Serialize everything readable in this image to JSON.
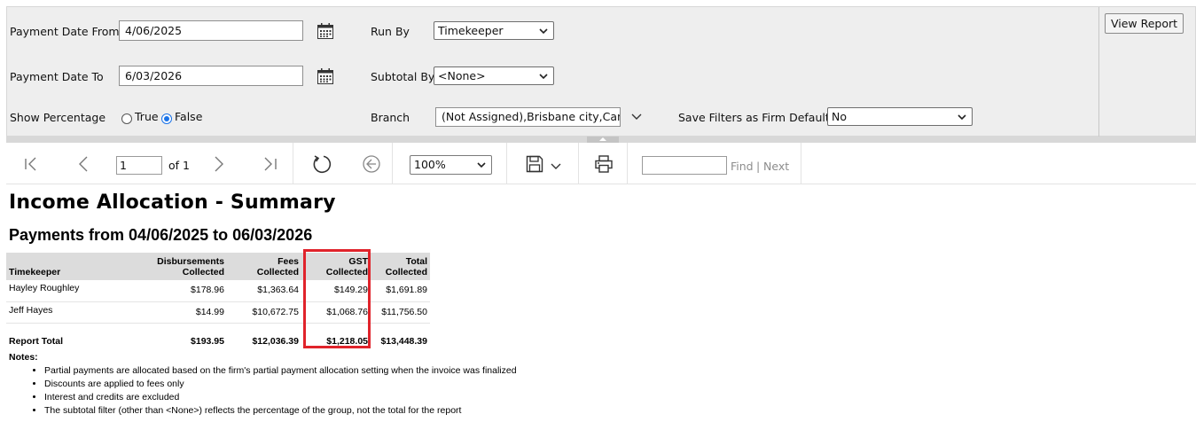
{
  "filters": {
    "payment_date_from": {
      "label": "Payment Date From",
      "value": "4/06/2025"
    },
    "payment_date_to": {
      "label": "Payment Date To",
      "value": "6/03/2026"
    },
    "show_percentage": {
      "label": "Show Percentage",
      "options": [
        "True",
        "False"
      ],
      "selected": "False"
    },
    "run_by": {
      "label": "Run By",
      "value": "Timekeeper"
    },
    "subtotal_by": {
      "label": "Subtotal By",
      "value": "<None>"
    },
    "branch": {
      "label": "Branch",
      "value": "(Not Assigned),Brisbane city,Canbe"
    },
    "save_filters": {
      "label": "Save Filters as Firm Default?",
      "value": "No"
    },
    "view_report_label": "View Report"
  },
  "toolbar": {
    "page_value": "1",
    "page_of": "of 1",
    "zoom": "100%",
    "find_value": "",
    "find_label": "Find",
    "find_sep": "|",
    "next_label": "Next"
  },
  "report": {
    "title": "Income Allocation - Summary",
    "subtitle": "Payments from 04/06/2025 to 06/03/2026",
    "columns": [
      {
        "line1": "",
        "line2": "Timekeeper"
      },
      {
        "line1": "Disbursements",
        "line2": "Collected"
      },
      {
        "line1": "Fees",
        "line2": "Collected"
      },
      {
        "line1": "GST",
        "line2": "Collected"
      },
      {
        "line1": "Total",
        "line2": "Collected"
      }
    ],
    "rows": [
      [
        "Hayley Roughley",
        "$178.96",
        "$1,363.64",
        "$149.29",
        "$1,691.89"
      ],
      [
        "Jeff Hayes",
        "$14.99",
        "$10,672.75",
        "$1,068.76",
        "$11,756.50"
      ]
    ],
    "total": [
      "Report Total",
      "$193.95",
      "$12,036.39",
      "$1,218.05",
      "$13,448.39"
    ],
    "notes_heading": "Notes:",
    "notes": [
      "Partial payments are allocated based on the firm's partial payment allocation setting when the invoice was finalized",
      "Discounts are applied to fees only",
      "Interest and credits are excluded",
      "The subtotal filter (other than <None>) reflects the percentage of the group, not the total for the report"
    ]
  },
  "colors": {
    "highlight": "#e0232b",
    "radio_checked": "#1a73e8",
    "panel_bg": "#eeeeee"
  }
}
